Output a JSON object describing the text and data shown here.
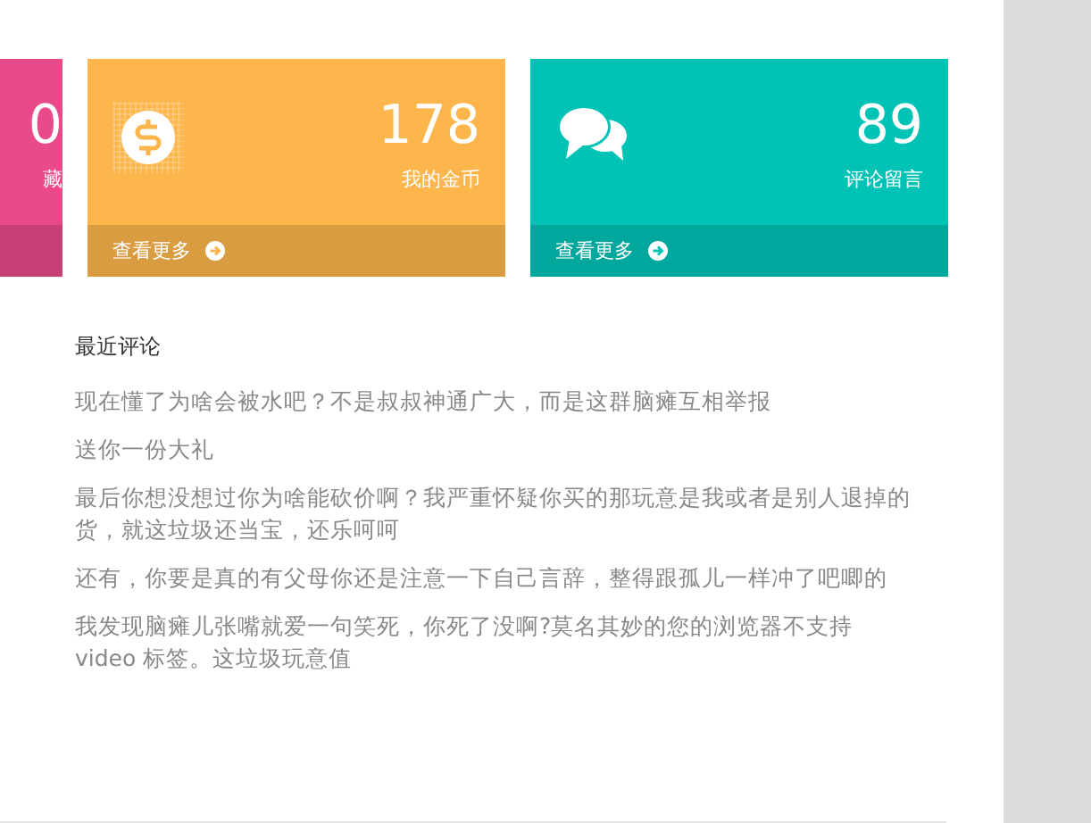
{
  "cards": [
    {
      "kind": "favorites",
      "number": "0",
      "label": "藏",
      "color": "#e94b8a"
    },
    {
      "kind": "coins",
      "number": "178",
      "label": "我的金币",
      "more": "查看更多",
      "color": "#fdb64b"
    },
    {
      "kind": "comments",
      "number": "89",
      "label": "评论留言",
      "more": "查看更多",
      "color": "#00c3b6"
    }
  ],
  "recent": {
    "title": "最近评论",
    "comments": [
      "现在懂了为啥会被水吧？不是叔叔神通广大，而是这群脑瘫互相举报",
      "送你一份大礼",
      "最后你想没想过你为啥能砍价啊？我严重怀疑你买的那玩意是我或者是别人退掉的货，就这垃圾还当宝，还乐呵呵",
      "还有，你要是真的有父母你还是注意一下自己言辞，整得跟孤儿一样冲了吧唧的",
      "我发现脑瘫儿张嘴就爱一句笑死，你死了没啊?莫名其妙的您的浏览器不支持 video 标签。这垃圾玩意值"
    ]
  }
}
